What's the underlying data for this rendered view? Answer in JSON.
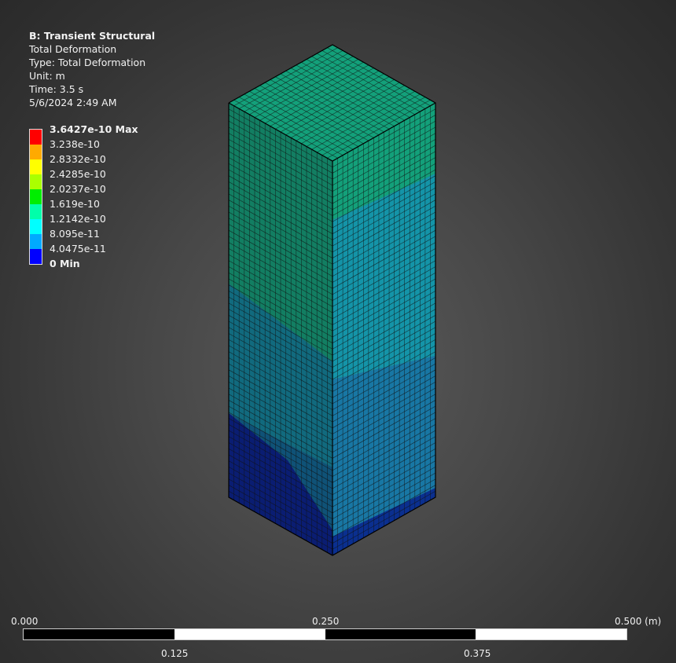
{
  "info": {
    "title": "B: Transient Structural",
    "result_name": "Total Deformation",
    "type_line": "Type: Total Deformation",
    "unit_line": "Unit: m",
    "time_line": "Time: 3.5 s",
    "date_line": "5/6/2024 2:49 AM"
  },
  "legend": {
    "entries": [
      {
        "label": "3.6427e-10 Max",
        "bold": true
      },
      {
        "label": "3.238e-10",
        "bold": false
      },
      {
        "label": "2.8332e-10",
        "bold": false
      },
      {
        "label": "2.4285e-10",
        "bold": false
      },
      {
        "label": "2.0237e-10",
        "bold": false
      },
      {
        "label": "1.619e-10",
        "bold": false
      },
      {
        "label": "1.2142e-10",
        "bold": false
      },
      {
        "label": "8.095e-11",
        "bold": false
      },
      {
        "label": "4.0475e-11",
        "bold": false
      },
      {
        "label": "0 Min",
        "bold": true
      }
    ],
    "band_colors": [
      "#ff0000",
      "#ffaa00",
      "#ffff00",
      "#aaff00",
      "#00ee00",
      "#00ffaa",
      "#00ffff",
      "#00aaff",
      "#0000ff"
    ]
  },
  "model_colors": {
    "top_face": "#13a07a",
    "mid_band": "#1494a8",
    "low_band": "#1877a4",
    "base_band": "#0a2f8f",
    "left_upper": "#127e62",
    "left_mid": "#116a7e",
    "left_low": "#0f5277",
    "left_base": "#0a1d72",
    "edge": "#111111"
  },
  "scale": {
    "labels_top": [
      "0.000",
      "0.250",
      "0.500 (m)"
    ],
    "labels_bottom": [
      "0.125",
      "0.375"
    ],
    "segment_colors": [
      "#000000",
      "#ffffff",
      "#000000",
      "#ffffff"
    ]
  }
}
